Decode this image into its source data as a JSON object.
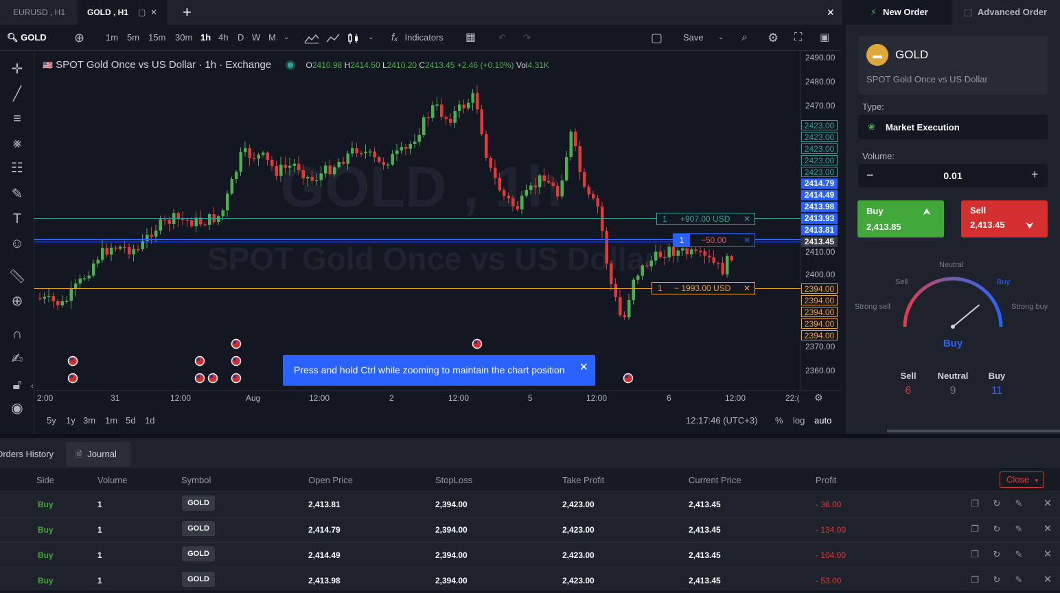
{
  "tabs": [
    {
      "label": "EURUSD , H1",
      "active": false
    },
    {
      "label": "GOLD , H1",
      "active": true
    }
  ],
  "toolbar": {
    "symbol": "GOLD",
    "intervals": [
      "1m",
      "5m",
      "15m",
      "30m",
      "1h",
      "4h",
      "D",
      "W",
      "M"
    ],
    "active_interval": "1h",
    "indicators_label": "Indicators",
    "save_label": "Save"
  },
  "legend": {
    "title": "SPOT Gold Once vs US Dollar · 1h · Exchange",
    "o_label": "O",
    "o": "2410.98",
    "h_label": "H",
    "h": "2414.50",
    "l_label": "L",
    "l": "2410.20",
    "c_label": "C",
    "c": "2413.45",
    "change": "+2.46 (+0.10%)",
    "vol_label": "Vol",
    "vol": "4.31K"
  },
  "watermark": {
    "main": "GOLD , 1h",
    "sub": "SPOT Gold Once vs US Dollar"
  },
  "price_axis": {
    "labels": [
      "2490.00",
      "2480.00",
      "2470.00",
      "2410.00",
      "2400.00",
      "2370.00",
      "2360.00"
    ],
    "tp_tags": [
      "2423.00",
      "2423.00",
      "2423.00",
      "2423.00",
      "2423.00"
    ],
    "entry_tags": [
      "2414.79",
      "2414.49",
      "2413.98",
      "2413.93",
      "2413.81"
    ],
    "current_tag": "2413.45",
    "sl_tags": [
      "2394.00",
      "2394.00",
      "2394.00",
      "2394.00",
      "2394.00"
    ]
  },
  "position_lines": {
    "tp": {
      "qty": "1",
      "text": "+907.00 USD"
    },
    "entry": {
      "qty": "1",
      "text": "−50.00"
    },
    "sl": {
      "qty": "1",
      "text": "− 1993.00 USD"
    }
  },
  "time_axis": [
    "2:00",
    "31",
    "12:00",
    "Aug",
    "12:00",
    "2",
    "12:00",
    "5",
    "12:00",
    "6",
    "12:00",
    "22:("
  ],
  "toast": "Press and hold Ctrl while zooming to maintain the chart position",
  "ranges": [
    "5y",
    "1y",
    "3m",
    "1m",
    "5d",
    "1d"
  ],
  "clock": "12:17:46 (UTC+3)",
  "scale_opts": [
    "%",
    "log",
    "auto"
  ],
  "colors": {
    "up": "#4caf50",
    "down": "#e53935",
    "buy": "#43a83a",
    "sell": "#d32f2f",
    "accent": "#2962ff",
    "sl": "#f7a21b",
    "tp": "#26a69a"
  },
  "right_panel": {
    "tab_new": "New Order",
    "tab_adv": "Advanced Order",
    "symbol": "GOLD",
    "symbol_desc": "SPOT Gold Once vs US Dollar",
    "type_label": "Type:",
    "type_value": "Market Execution",
    "volume_label": "Volume:",
    "volume_value": "0.01",
    "buy_label": "Buy",
    "buy_price": "2,413.85",
    "sell_label": "Sell",
    "sell_price": "2,413.45",
    "gauge": {
      "neutral": "Neutral",
      "sell": "Sell",
      "buy": "Buy",
      "strong_sell": "Strong sell",
      "strong_buy": "Strong buy",
      "result": "Buy",
      "needle_value": 0.78
    },
    "counts": [
      {
        "label": "Sell",
        "value": "6"
      },
      {
        "label": "Neutral",
        "value": "9"
      },
      {
        "label": "Buy",
        "value": "11"
      }
    ]
  },
  "bottom": {
    "tab_history": "Orders History",
    "tab_journal": "Journal",
    "columns": [
      "Side",
      "Volume",
      "Symbol",
      "Open Price",
      "StopLoss",
      "Take Profit",
      "Current Price",
      "Profit"
    ],
    "close_label": "Close",
    "rows": [
      {
        "side": "Buy",
        "volume": "1",
        "symbol": "GOLD",
        "open": "2,413.81",
        "sl": "2,394.00",
        "tp": "2,423.00",
        "current": "2,413.45",
        "profit": "- 36.00"
      },
      {
        "side": "Buy",
        "volume": "1",
        "symbol": "GOLD",
        "open": "2,414.79",
        "sl": "2,394.00",
        "tp": "2,423.00",
        "current": "2,413.45",
        "profit": "- 134.00"
      },
      {
        "side": "Buy",
        "volume": "1",
        "symbol": "GOLD",
        "open": "2,414.49",
        "sl": "2,394.00",
        "tp": "2,423.00",
        "current": "2,413.45",
        "profit": "- 104.00"
      },
      {
        "side": "Buy",
        "volume": "1",
        "symbol": "GOLD",
        "open": "2,413.98",
        "sl": "2,394.00",
        "tp": "2,423.00",
        "current": "2,413.45",
        "profit": "- 53.00"
      }
    ]
  }
}
